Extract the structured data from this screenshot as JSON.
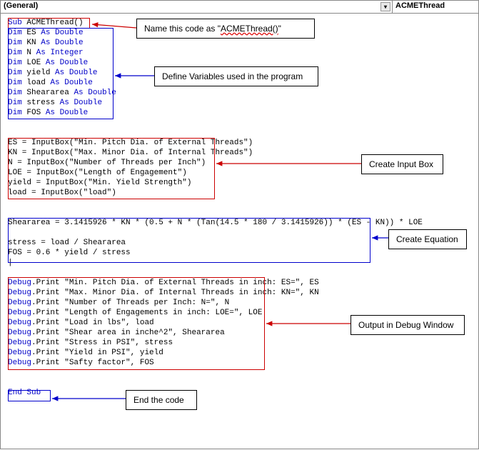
{
  "topbar": {
    "left": "(General)",
    "right": "ACMEThread"
  },
  "code": {
    "sub": "Sub",
    "subname": " ACMEThread()",
    "dim": "Dim",
    "as": "As",
    "double": "Double",
    "integer": "Integer",
    "var_es": " ES ",
    "var_kn": " KN ",
    "var_n": " N ",
    "var_loe": " LOE ",
    "var_yield": " yield ",
    "var_load": " load ",
    "var_shear": " Sheararea ",
    "var_stress": " stress ",
    "var_fos": " FOS ",
    "input1": "ES = InputBox(\"Min. Pitch Dia. of External Threads\")",
    "input2": "KN = InputBox(\"Max. Minor Dia. of Internal Threads\")",
    "input3": "N = InputBox(\"Number of Threads per Inch\")",
    "input4": "LOE = InputBox(\"Length of Engagement\")",
    "input5": "yield = InputBox(\"Min. Yield Strength\")",
    "input6": "load = InputBox(\"load\")",
    "eq1": "Sheararea = 3.1415926 * KN * (0.5 + N * (Tan(14.5 * 180 / 3.1415926)) * (ES - KN)) * LOE",
    "eq2": "stress = load / Sheararea",
    "eq3": "FOS = 0.6 * yield / stress",
    "cursor": "|",
    "dbg": "Debug",
    "print": ".Print ",
    "dbg1": "\"Min. Pitch Dia. of External Threads in inch: ES=\", ES",
    "dbg2": "\"Max. Minor Dia. of Internal Threads in inch: KN=\", KN",
    "dbg3": "\"Number of Threads per Inch: N=\", N",
    "dbg4": "\"Length of Engagements in inch: LOE=\", LOE",
    "dbg5": "\"Load in lbs\", load",
    "dbg6": "\"Shear area in inche^2\", Sheararea",
    "dbg7": "\"Stress in PSI\", stress",
    "dbg8": "\"Yield in PSI\", yield",
    "dbg9": "\"Safty factor\", FOS",
    "endsub": "End Sub"
  },
  "annot": {
    "name": "Name this code as \"",
    "name2": "ACMEThread()",
    "name3": "\"",
    "define": "Define Variables used in the program",
    "input": "Create Input Box",
    "equation": "Create Equation",
    "output": "Output in Debug Window",
    "end": "End the code"
  }
}
